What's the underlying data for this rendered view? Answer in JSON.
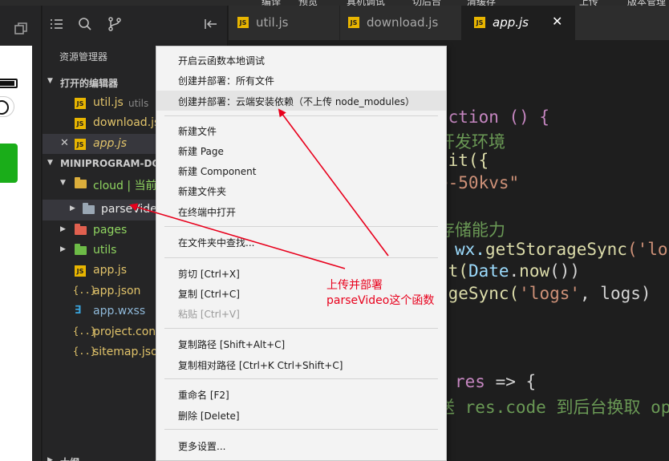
{
  "topbar": {
    "items": [
      "编译",
      "预览",
      "真机调试",
      "切后台",
      "清缓存",
      "上传",
      "版本管理"
    ]
  },
  "explorer": {
    "title": "资源管理器",
    "open_editors_label": "打开的编辑器",
    "open_editors": [
      {
        "name": "util.js",
        "hint": "utils",
        "icon": "js-file-icon"
      },
      {
        "name": "download.js",
        "hint": "",
        "icon": "js-file-icon"
      },
      {
        "name": "app.js",
        "hint": "",
        "icon": "js-file-icon"
      }
    ],
    "project_label": "MINIPROGRAM-DO",
    "tree": [
      {
        "name": "cloud | 当前",
        "icon": "cloud-folder-icon"
      },
      {
        "name": "parseVideo",
        "icon": "folder-icon"
      },
      {
        "name": "pages",
        "icon": "pages-folder-icon"
      },
      {
        "name": "utils",
        "icon": "utils-folder-icon"
      },
      {
        "name": "app.js",
        "icon": "js-file-icon"
      },
      {
        "name": "app.json",
        "icon": "json-file-icon"
      },
      {
        "name": "app.wxss",
        "icon": "css-file-icon"
      },
      {
        "name": "project.con",
        "icon": "json-file-icon"
      },
      {
        "name": "sitemap.jso",
        "icon": "json-file-icon"
      }
    ],
    "outline_label": "大纲"
  },
  "tabs": [
    {
      "name": "util.js",
      "active": false
    },
    {
      "name": "download.js",
      "active": false
    },
    {
      "name": "app.js",
      "active": true
    }
  ],
  "tab_close": "✕",
  "code": {
    "l1": "nction () {",
    "l2": "开发环境",
    "l3": "nit({",
    "l4": "e-50kvs\"",
    "l5": "存储能力",
    "l6a": "wx.",
    "l6b": "getStorageSync",
    "l6c": "('lo",
    "l7a": "ft(",
    "l7b": "Date",
    "l7c": ".",
    "l7d": "now",
    "l7e": "())",
    "l8a": "ageSync(",
    "l8b": "'logs'",
    "l8c": ", logs)",
    "l9a": "res",
    "l9b": " => {",
    "l10a": "送 ",
    "l10b": "res.code 到后台换取 op"
  },
  "context_menu": {
    "items": [
      {
        "label": "开启云函数本地调试"
      },
      {
        "label": "创建并部署：所有文件"
      },
      {
        "label": "创建并部署：云端安装依赖（不上传 node_modules）"
      },
      {
        "label": "新建文件"
      },
      {
        "label": "新建 Page"
      },
      {
        "label": "新建 Component"
      },
      {
        "label": "新建文件夹"
      },
      {
        "label": "在终端中打开"
      },
      {
        "label": "在文件夹中查找..."
      },
      {
        "label": "剪切  [Ctrl+X]"
      },
      {
        "label": "复制  [Ctrl+C]"
      },
      {
        "label": "粘贴  [Ctrl+V]"
      },
      {
        "label": "复制路径  [Shift+Alt+C]"
      },
      {
        "label": "复制相对路径  [Ctrl+K Ctrl+Shift+C]"
      },
      {
        "label": "重命名  [F2]"
      },
      {
        "label": "删除  [Delete]"
      },
      {
        "label": "更多设置..."
      }
    ]
  },
  "annotation": {
    "line1": "上传并部署",
    "line2": "parseVideo这个函数",
    "color": "#e8001c"
  }
}
